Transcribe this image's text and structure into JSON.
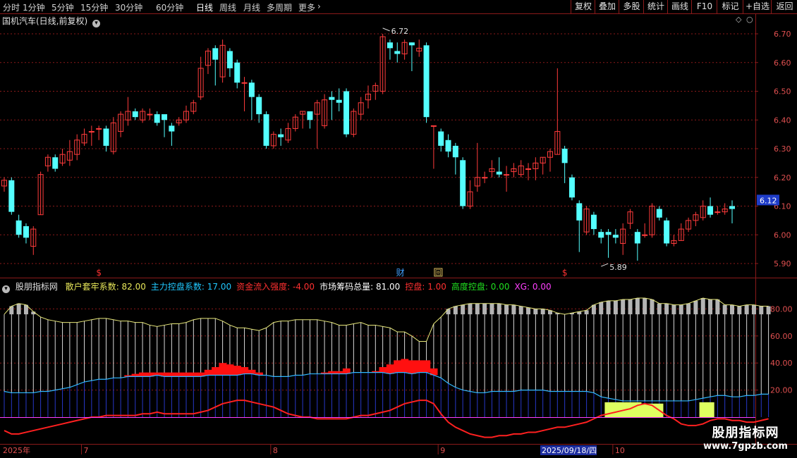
{
  "toolbar": {
    "periods": [
      "分时",
      "1分钟",
      "5分钟",
      "15分钟",
      "30分钟",
      "60分钟",
      "日线",
      "周线",
      "月线",
      "多周期",
      "更多"
    ],
    "active_period": "日线",
    "more_arrow": "›",
    "right_buttons": [
      "复权",
      "叠加",
      "多股",
      "统计",
      "画线",
      "F10",
      "标记",
      "+自选",
      "返回"
    ]
  },
  "stock_title": "国机汽车(日线,前复权)",
  "price_axis": {
    "labels": [
      "6.70",
      "6.60",
      "6.50",
      "6.40",
      "6.30",
      "6.20",
      "6.10",
      "6.00",
      "5.90"
    ],
    "current": "6.12",
    "current_color": "#1e3cc8"
  },
  "annotations": {
    "high": "6.72",
    "low": "5.89",
    "cai_marker": "财",
    "hui_marker": "回",
    "dollar_marker": "$"
  },
  "indicator": {
    "name": "股朋指标网",
    "fields": [
      {
        "label": "散户套牢系数",
        "value": "82.00",
        "color": "#e8e85a"
      },
      {
        "label": "主力控盘系数",
        "value": "17.00",
        "color": "#20c8ff"
      },
      {
        "label": "资金流入强度",
        "value": "-4.00",
        "color": "#ff3030"
      },
      {
        "label": "市场筹码总量",
        "value": "81.00",
        "color": "#ffffff"
      },
      {
        "label": "控盘",
        "value": "1.00",
        "color": "#ff3030"
      },
      {
        "label": "高度控盘",
        "value": "0.00",
        "color": "#20e020"
      },
      {
        "label": "XG",
        "value": "0.00",
        "color": "#ff40ff"
      }
    ],
    "axis_labels": [
      "80.00",
      "60.00",
      "40.00",
      "20.00"
    ]
  },
  "date_axis": {
    "year": "2025年",
    "months": [
      "7",
      "8",
      "9",
      "10"
    ],
    "cursor_date": "2025/09/18/四"
  },
  "watermark": {
    "line1": "股朋指标网",
    "line2": "www.7gpzb.com"
  },
  "colors": {
    "up": "#ff3b3b",
    "down": "#54ffff",
    "grid": "#8b1a1a",
    "bg": "#000000"
  },
  "chart_data": {
    "type": "candlestick",
    "price_range": [
      5.87,
      6.74
    ],
    "candles": [
      [
        6.17,
        6.19,
        6.2,
        6.15
      ],
      [
        6.19,
        6.08,
        6.2,
        6.07
      ],
      [
        6.05,
        6.0,
        6.07,
        5.99
      ],
      [
        6.03,
        5.99,
        6.04,
        5.97
      ],
      [
        5.96,
        6.02,
        6.03,
        5.93
      ],
      [
        6.07,
        6.21,
        6.22,
        6.07
      ],
      [
        6.24,
        6.27,
        6.28,
        6.22
      ],
      [
        6.27,
        6.23,
        6.28,
        6.22
      ],
      [
        6.25,
        6.28,
        6.3,
        6.24
      ],
      [
        6.26,
        6.29,
        6.33,
        6.24
      ],
      [
        6.28,
        6.33,
        6.35,
        6.26
      ],
      [
        6.32,
        6.35,
        6.37,
        6.31
      ],
      [
        6.36,
        6.36,
        6.38,
        6.31
      ],
      [
        6.37,
        6.37,
        6.38,
        6.33
      ],
      [
        6.37,
        6.31,
        6.38,
        6.29
      ],
      [
        6.29,
        6.39,
        6.41,
        6.28
      ],
      [
        6.36,
        6.42,
        6.43,
        6.34
      ],
      [
        6.4,
        6.43,
        6.48,
        6.38
      ],
      [
        6.43,
        6.41,
        6.44,
        6.4
      ],
      [
        6.4,
        6.43,
        6.44,
        6.39
      ],
      [
        6.42,
        6.42,
        6.44,
        6.4
      ],
      [
        6.42,
        6.39,
        6.43,
        6.38
      ],
      [
        6.42,
        6.4,
        6.41,
        6.34
      ],
      [
        6.38,
        6.36,
        6.39,
        6.31
      ],
      [
        6.39,
        6.4,
        6.41,
        6.38
      ],
      [
        6.4,
        6.43,
        6.45,
        6.39
      ],
      [
        6.43,
        6.46,
        6.47,
        6.42
      ],
      [
        6.48,
        6.58,
        6.62,
        6.47
      ],
      [
        6.59,
        6.64,
        6.65,
        6.56
      ],
      [
        6.65,
        6.61,
        6.66,
        6.52
      ],
      [
        6.55,
        6.66,
        6.68,
        6.53
      ],
      [
        6.64,
        6.58,
        6.65,
        6.55
      ],
      [
        6.6,
        6.53,
        6.61,
        6.51
      ],
      [
        6.53,
        6.53,
        6.55,
        6.43
      ],
      [
        6.53,
        6.48,
        6.54,
        6.4
      ],
      [
        6.48,
        6.42,
        6.49,
        6.39
      ],
      [
        6.42,
        6.31,
        6.43,
        6.3
      ],
      [
        6.31,
        6.35,
        6.36,
        6.3
      ],
      [
        6.35,
        6.34,
        6.37,
        6.31
      ],
      [
        6.33,
        6.37,
        6.39,
        6.32
      ],
      [
        6.37,
        6.41,
        6.42,
        6.36
      ],
      [
        6.42,
        6.43,
        6.43,
        6.37
      ],
      [
        6.43,
        6.4,
        6.41,
        6.37
      ],
      [
        6.42,
        6.46,
        6.47,
        6.3
      ],
      [
        6.38,
        6.47,
        6.49,
        6.37
      ],
      [
        6.48,
        6.47,
        6.5,
        6.4
      ],
      [
        6.47,
        6.46,
        6.51,
        6.43
      ],
      [
        6.5,
        6.35,
        6.51,
        6.34
      ],
      [
        6.35,
        6.43,
        6.44,
        6.34
      ],
      [
        6.42,
        6.46,
        6.48,
        6.4
      ],
      [
        6.47,
        6.49,
        6.52,
        6.44
      ],
      [
        6.5,
        6.52,
        6.53,
        6.47
      ],
      [
        6.5,
        6.69,
        6.7,
        6.49
      ],
      [
        6.67,
        6.65,
        6.68,
        6.61
      ],
      [
        6.64,
        6.63,
        6.67,
        6.6
      ],
      [
        6.63,
        6.67,
        6.68,
        6.61
      ],
      [
        6.67,
        6.66,
        6.67,
        6.57
      ],
      [
        6.64,
        6.65,
        6.68,
        6.62
      ],
      [
        6.66,
        6.41,
        6.67,
        6.39
      ],
      [
        6.38,
        6.38,
        6.38,
        6.23
      ],
      [
        6.36,
        6.31,
        6.37,
        6.29
      ],
      [
        6.33,
        6.29,
        6.35,
        6.27
      ],
      [
        6.31,
        6.27,
        6.32,
        6.21
      ],
      [
        6.26,
        6.1,
        6.27,
        6.09
      ],
      [
        6.1,
        6.15,
        6.19,
        6.09
      ],
      [
        6.17,
        6.2,
        6.32,
        6.15
      ],
      [
        6.2,
        6.2,
        6.22,
        6.18
      ],
      [
        6.22,
        6.23,
        6.26,
        6.2
      ],
      [
        6.22,
        6.21,
        6.27,
        6.2
      ],
      [
        6.21,
        6.21,
        6.24,
        6.15
      ],
      [
        6.22,
        6.23,
        6.25,
        6.2
      ],
      [
        6.21,
        6.24,
        6.26,
        6.2
      ],
      [
        6.23,
        6.23,
        6.25,
        6.19
      ],
      [
        6.23,
        6.25,
        6.27,
        6.19
      ],
      [
        6.25,
        6.27,
        6.27,
        6.21
      ],
      [
        6.27,
        6.29,
        6.3,
        6.22
      ],
      [
        6.28,
        6.36,
        6.58,
        6.28
      ],
      [
        6.3,
        6.25,
        6.31,
        6.18
      ],
      [
        6.2,
        6.13,
        6.21,
        6.12
      ],
      [
        6.11,
        6.05,
        6.12,
        5.94
      ],
      [
        6.01,
        6.09,
        6.1,
        6.0
      ],
      [
        6.07,
        6.02,
        6.08,
        6.0
      ],
      [
        6.01,
        5.99,
        6.02,
        5.97
      ],
      [
        6.01,
        6.0,
        6.02,
        5.92
      ],
      [
        6.0,
        5.99,
        6.02,
        5.97
      ],
      [
        5.97,
        6.02,
        6.04,
        5.93
      ],
      [
        6.04,
        6.08,
        6.09,
        6.02
      ],
      [
        6.01,
        5.97,
        6.02,
        5.91
      ],
      [
        6.0,
        6.0,
        6.04,
        5.99
      ],
      [
        6.0,
        6.1,
        6.11,
        5.99
      ],
      [
        6.09,
        6.06,
        6.1,
        6.05
      ],
      [
        6.05,
        5.97,
        6.06,
        5.96
      ],
      [
        5.97,
        5.98,
        6.0,
        5.96
      ],
      [
        5.98,
        6.02,
        6.04,
        5.98
      ],
      [
        6.02,
        6.05,
        6.06,
        6.01
      ],
      [
        6.05,
        6.07,
        6.08,
        6.03
      ],
      [
        6.06,
        6.1,
        6.12,
        6.05
      ],
      [
        6.1,
        6.07,
        6.13,
        6.06
      ],
      [
        6.08,
        6.08,
        6.1,
        6.07
      ],
      [
        6.08,
        6.09,
        6.11,
        6.07
      ],
      [
        6.1,
        6.09,
        6.12,
        6.04
      ]
    ],
    "indicator_range": [
      0,
      100
    ],
    "san_hu": [
      76,
      82,
      84,
      83,
      78,
      74,
      72,
      71,
      70,
      70,
      70,
      71,
      72,
      73,
      73,
      72,
      71,
      71,
      70,
      70,
      68,
      67,
      68,
      69,
      69,
      70,
      72,
      73,
      73,
      73,
      71,
      68,
      66,
      66,
      65,
      64,
      66,
      70,
      71,
      71,
      72,
      72,
      72,
      72,
      71,
      70,
      68,
      68,
      69,
      70,
      68,
      68,
      67,
      66,
      63,
      63,
      60,
      56,
      56,
      69,
      74,
      80,
      82,
      83,
      84,
      84,
      84,
      84,
      84,
      83,
      83,
      82,
      81,
      80,
      80,
      79,
      77,
      76,
      77,
      78,
      79,
      83,
      85,
      86,
      86,
      87,
      87,
      88,
      88,
      87,
      84,
      84,
      83,
      83,
      84,
      86,
      88,
      87,
      87,
      83,
      83,
      82,
      83,
      83,
      82,
      82
    ],
    "zhu_li": [
      19,
      18,
      18,
      18,
      18,
      19,
      19,
      20,
      21,
      22,
      24,
      26,
      27,
      28,
      28,
      29,
      29,
      30,
      30,
      30,
      30,
      31,
      30,
      30,
      30,
      30,
      30,
      30,
      31,
      31,
      31,
      31,
      31,
      32,
      32,
      31,
      31,
      30,
      30,
      30,
      31,
      31,
      32,
      32,
      32,
      32,
      32,
      32,
      33,
      33,
      33,
      33,
      33,
      32,
      33,
      33,
      32,
      33,
      33,
      31,
      29,
      25,
      22,
      20,
      19,
      18,
      18,
      19,
      19,
      19,
      19,
      20,
      20,
      20,
      20,
      19,
      19,
      19,
      19,
      19,
      19,
      18,
      15,
      14,
      13,
      12,
      12,
      12,
      12,
      12,
      12,
      12,
      12,
      12,
      12,
      13,
      14,
      15,
      16,
      16,
      15,
      15,
      16,
      16,
      17,
      17
    ],
    "zi_jin": [
      0,
      0,
      0,
      0,
      0,
      0,
      0,
      0,
      0,
      0,
      0,
      0,
      0,
      0,
      0,
      0,
      29,
      31,
      32,
      33,
      33,
      33,
      33,
      33,
      33,
      33,
      33,
      33,
      35,
      37,
      40,
      39,
      38,
      37,
      35,
      33,
      29,
      0,
      0,
      0,
      0,
      0,
      32,
      32,
      33,
      34,
      34,
      36,
      0,
      0,
      0,
      34,
      37,
      39,
      42,
      43,
      42,
      42,
      42,
      36,
      0,
      0,
      0,
      0,
      0,
      0,
      0,
      0,
      0,
      0,
      0,
      0,
      0,
      0,
      0,
      0,
      0,
      0,
      0,
      0,
      0,
      0,
      0,
      0,
      0,
      0,
      0,
      0,
      0,
      0,
      0,
      0,
      0,
      0,
      0,
      0,
      0,
      0,
      0,
      0,
      0,
      0,
      0,
      0,
      0,
      0
    ],
    "gao_du": [
      0,
      0,
      0,
      0,
      0,
      0,
      0,
      0,
      0,
      0,
      0,
      0,
      0,
      0,
      0,
      0,
      0,
      0,
      0,
      0,
      0,
      0,
      0,
      0,
      0,
      0,
      0,
      0,
      0,
      0,
      0,
      0,
      0,
      0,
      0,
      0,
      0,
      0,
      0,
      0,
      0,
      0,
      0,
      0,
      0,
      0,
      0,
      0,
      0,
      0,
      0,
      0,
      0,
      0,
      0,
      0,
      0,
      0,
      0,
      0,
      0,
      0,
      0,
      0,
      0,
      0,
      0,
      0,
      0,
      0,
      0,
      0,
      0,
      0,
      0,
      0,
      0,
      0,
      0,
      0,
      0,
      0,
      0,
      8,
      8,
      8,
      8,
      8,
      7,
      7,
      7,
      0,
      0,
      0,
      0,
      0,
      8,
      8,
      0,
      0,
      0,
      0,
      0,
      0,
      0,
      0
    ],
    "red_line": [
      -8,
      -10,
      -10,
      -9,
      -8,
      -7,
      -6,
      -5,
      -4,
      -3,
      -2,
      -1,
      0,
      0,
      1,
      1,
      1,
      1,
      1,
      2,
      2,
      3,
      2,
      2,
      2,
      2,
      2,
      3,
      4,
      6,
      8,
      9,
      10,
      10,
      9,
      8,
      7,
      6,
      4,
      2,
      1,
      0,
      0,
      -1,
      -1,
      -1,
      -1,
      -1,
      0,
      1,
      1,
      2,
      3,
      4,
      6,
      8,
      9,
      10,
      10,
      8,
      2,
      -3,
      -6,
      -8,
      -10,
      -11,
      -12,
      -12,
      -11,
      -11,
      -10,
      -10,
      -9,
      -9,
      -8,
      -7,
      -6,
      -6,
      -5,
      -4,
      -3,
      -1,
      1,
      2,
      3,
      4,
      5,
      7,
      8,
      7,
      4,
      1,
      -1,
      -4,
      -5,
      -5,
      -4,
      -2,
      -1,
      -1,
      -2,
      -2,
      -3,
      -3,
      -2,
      -1
    ]
  }
}
